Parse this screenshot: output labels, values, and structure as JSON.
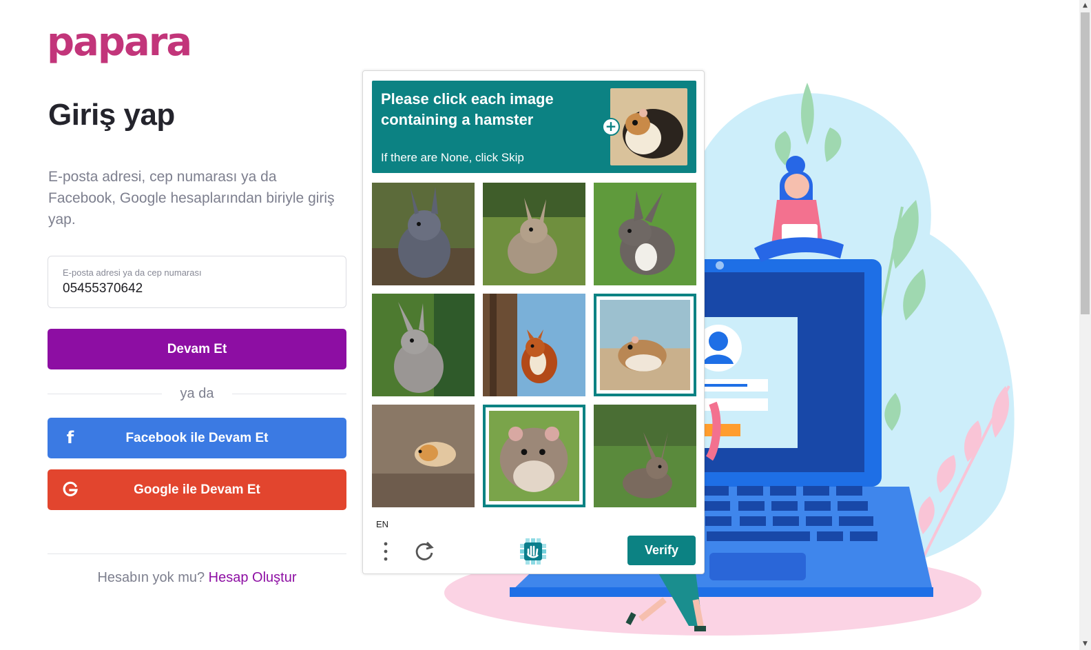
{
  "brand": {
    "logo": "papara"
  },
  "login": {
    "title": "Giriş yap",
    "subtitle": "E-posta adresi, cep numarası ya da Facebook, Google hesaplarından biriyle giriş yap.",
    "field_label": "E-posta adresi ya da cep numarası",
    "field_value": "05455370642",
    "continue_label": "Devam Et",
    "or_label": "ya da",
    "facebook_label": "Facebook ile Devam Et",
    "google_label": "Google ile Devam Et",
    "signup_prompt": "Hesabın yok mu?",
    "signup_link": "Hesap Oluştur"
  },
  "captcha": {
    "prompt": "Please click each image containing a hamster",
    "hint": "If there are None, click Skip",
    "language": "EN",
    "verify_label": "Verify",
    "tiles": [
      {
        "subject": "rabbit",
        "selected": false
      },
      {
        "subject": "rabbit",
        "selected": false
      },
      {
        "subject": "rabbit",
        "selected": false
      },
      {
        "subject": "rabbit",
        "selected": false
      },
      {
        "subject": "squirrel",
        "selected": false
      },
      {
        "subject": "hamster",
        "selected": true
      },
      {
        "subject": "hamster",
        "selected": false
      },
      {
        "subject": "hamster",
        "selected": true
      },
      {
        "subject": "rabbit",
        "selected": false
      }
    ]
  },
  "colors": {
    "brand_purple": "#8d0ea3",
    "facebook_blue": "#3b7ae3",
    "google_red": "#e2452e",
    "captcha_teal": "#0c8283"
  }
}
